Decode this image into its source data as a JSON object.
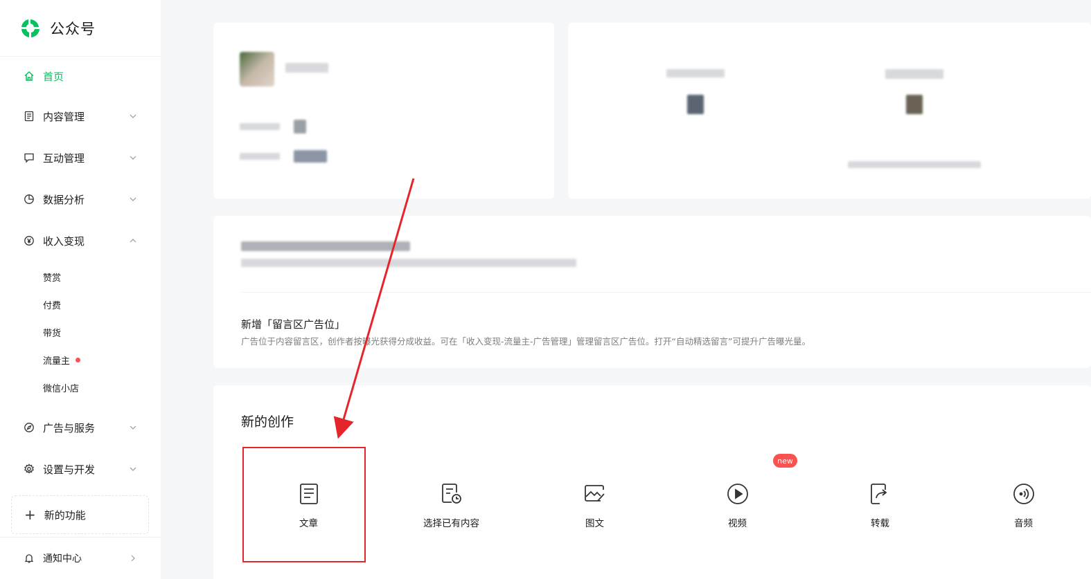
{
  "app": {
    "title": "公众号",
    "brand_color": "#07c160"
  },
  "sidebar": {
    "items": [
      {
        "label": "首页",
        "icon": "home-icon",
        "active": true
      },
      {
        "label": "内容管理",
        "icon": "document-icon",
        "chevron": "down"
      },
      {
        "label": "互动管理",
        "icon": "chat-icon",
        "chevron": "down"
      },
      {
        "label": "数据分析",
        "icon": "pie-chart-icon",
        "chevron": "down"
      },
      {
        "label": "收入变现",
        "icon": "yen-icon",
        "chevron": "up"
      }
    ],
    "sub_items": [
      {
        "label": "赞赏"
      },
      {
        "label": "付费"
      },
      {
        "label": "带货"
      },
      {
        "label": "流量主",
        "dot": true
      },
      {
        "label": "微信小店"
      }
    ],
    "items_after": [
      {
        "label": "广告与服务",
        "icon": "compass-icon",
        "chevron": "down"
      },
      {
        "label": "设置与开发",
        "icon": "gear-icon",
        "chevron": "down"
      }
    ],
    "new_feature": {
      "label": "新的功能"
    },
    "bottom": {
      "label": "通知中心",
      "icon": "bell-icon"
    }
  },
  "notice": {
    "title": "新增「留言区广告位」",
    "desc": "广告位于内容留言区，创作者按曝光获得分成收益。可在「收入变现-流量主-广告管理」管理留言区广告位。打开“自动精选留言”可提升广告曝光量。"
  },
  "create": {
    "title": "新的创作",
    "items": [
      {
        "label": "文章",
        "icon": "article-icon"
      },
      {
        "label": "选择已有内容",
        "icon": "existing-content-icon"
      },
      {
        "label": "图文",
        "icon": "image-text-icon"
      },
      {
        "label": "视频",
        "icon": "video-play-icon",
        "badge": "new"
      },
      {
        "label": "转载",
        "icon": "repost-icon"
      },
      {
        "label": "音频",
        "icon": "audio-icon"
      }
    ]
  },
  "annotation": {
    "color": "#e5252a"
  }
}
